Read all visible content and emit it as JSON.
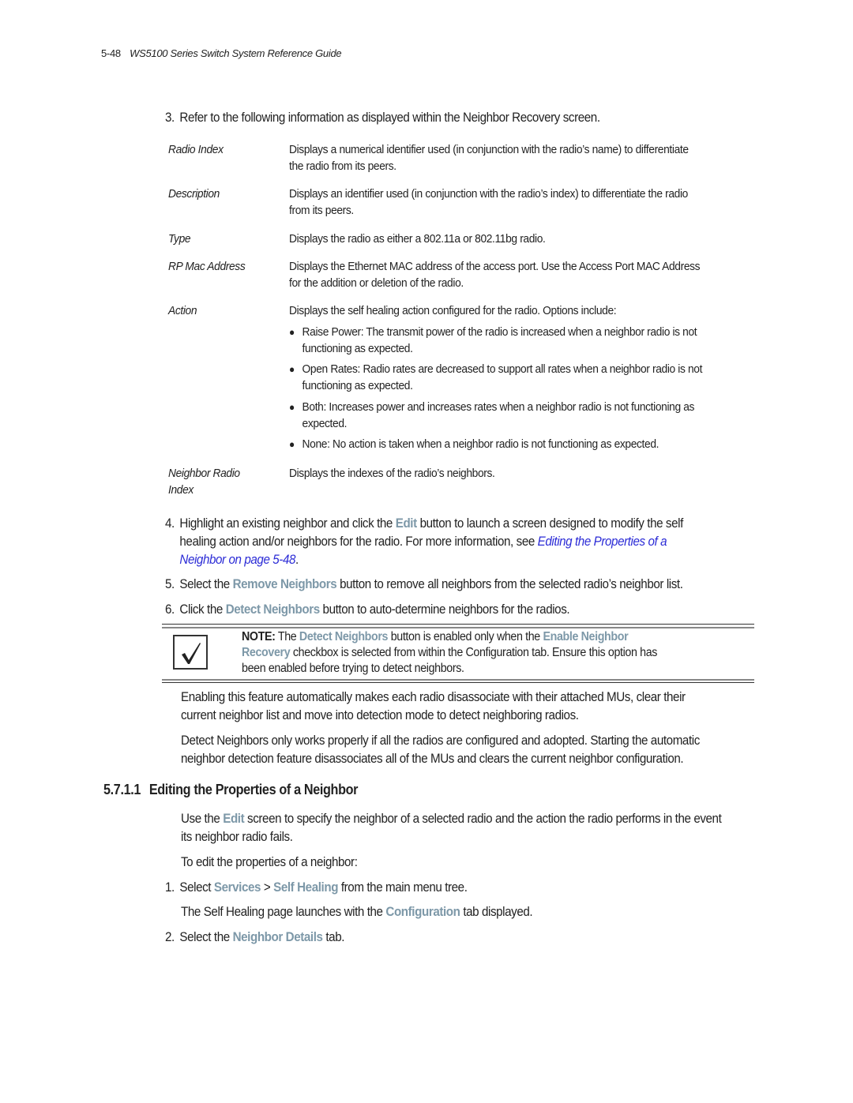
{
  "header": {
    "page_number": "5-48",
    "guide_title": "WS5100 Series Switch System Reference Guide"
  },
  "step3": {
    "number": "3.",
    "text": "Refer to the following information as displayed within the Neighbor Recovery screen."
  },
  "fields": [
    {
      "term": "Radio Index",
      "lines": [
        "Displays a numerical identifier used (in conjunction with the radio’s name) to differentiate",
        "the radio from its peers."
      ]
    },
    {
      "term": "Description",
      "lines": [
        "Displays an identifier used (in conjunction with the radio’s index) to differentiate the radio",
        "from its peers."
      ]
    },
    {
      "term": "Type",
      "lines": [
        "Displays the radio as either a 802.11a or 802.11bg radio."
      ]
    },
    {
      "term": "RP Mac Address",
      "lines": [
        "Displays the Ethernet MAC address of the access port. Use the Access Port MAC Address",
        "for the addition or deletion of the radio."
      ]
    },
    {
      "term": "Action",
      "lines": [
        "Displays the self healing action configured for the radio. Options include:"
      ]
    },
    {
      "term_lines": [
        "Neighbor Radio",
        "Index"
      ],
      "lines": [
        "Displays the indexes of the radio’s neighbors."
      ]
    }
  ],
  "action_options": [
    {
      "lines": [
        "Raise Power: The transmit power of the radio is increased when a neighbor radio is not",
        "functioning as expected."
      ]
    },
    {
      "lines": [
        "Open Rates: Radio rates are decreased to support all rates when a neighbor radio is not",
        "functioning as expected."
      ]
    },
    {
      "lines": [
        "Both: Increases power and increases rates when a neighbor radio is not functioning as",
        "expected."
      ]
    },
    {
      "lines": [
        "None: No action is taken when a neighbor radio is not functioning as expected."
      ]
    }
  ],
  "step4": {
    "number": "4.",
    "pre": "Highlight an existing neighbor and click the ",
    "ui_edit": "Edit",
    "post1": " button to launch a screen designed to modify the self",
    "line2_pre": "healing action and/or neighbors for the radio. For more information, see ",
    "xref_part1": "Editing the Properties of a",
    "xref_part2": "Neighbor on page 5-48",
    "line3_post": "."
  },
  "step5": {
    "number": "5.",
    "pre": "Select the ",
    "ui": "Remove Neighbors",
    "post": " button to remove all neighbors from the selected radio’s neighbor list."
  },
  "step6": {
    "number": "6.",
    "pre": "Click the ",
    "ui": "Detect Neighbors",
    "post": " button to auto-determine neighbors for the radios."
  },
  "note": {
    "label": "NOTE:",
    "l1_a": " The ",
    "l1_ui1": "Detect Neighbors",
    "l1_b": " button is enabled only when the ",
    "l1_ui2": "Enable Neighbor",
    "l2_ui": "Recovery",
    "l2_b": " checkbox is selected from within the Configuration tab. Ensure this option has",
    "l3": "been enabled before trying to detect neighbors.",
    "icon": "checkmark-icon"
  },
  "paragraphs": [
    {
      "lines": [
        "Enabling this feature automatically makes each radio disassociate with their attached MUs, clear their",
        "current neighbor list and move into detection mode to detect neighboring radios."
      ]
    },
    {
      "lines": [
        "Detect Neighbors only works properly if all the radios are configured and adopted. Starting the automatic",
        "neighbor detection feature disassociates all of the MUs and clears the current neighbor configuration."
      ]
    }
  ],
  "section": {
    "number": "5.7.1.1",
    "title": "Editing the Properties of a Neighbor",
    "intro_pre": "Use the ",
    "intro_ui": "Edit",
    "intro_post": " screen to specify the neighbor of a selected radio and the action the radio performs in the event",
    "intro_line2": "its neighbor radio fails.",
    "lead": "To edit the properties of a neighbor:",
    "step1": {
      "number": "1.",
      "pre": "Select ",
      "ui1": "Services",
      "sep": " > ",
      "ui2": "Self Healing",
      "post": " from the main menu tree."
    },
    "step1_note": {
      "pre": "The Self Healing page launches with the ",
      "ui": "Configuration",
      "post": " tab displayed."
    },
    "step2": {
      "number": "2.",
      "pre": "Select the ",
      "ui": "Neighbor Details",
      "post": " tab."
    }
  }
}
